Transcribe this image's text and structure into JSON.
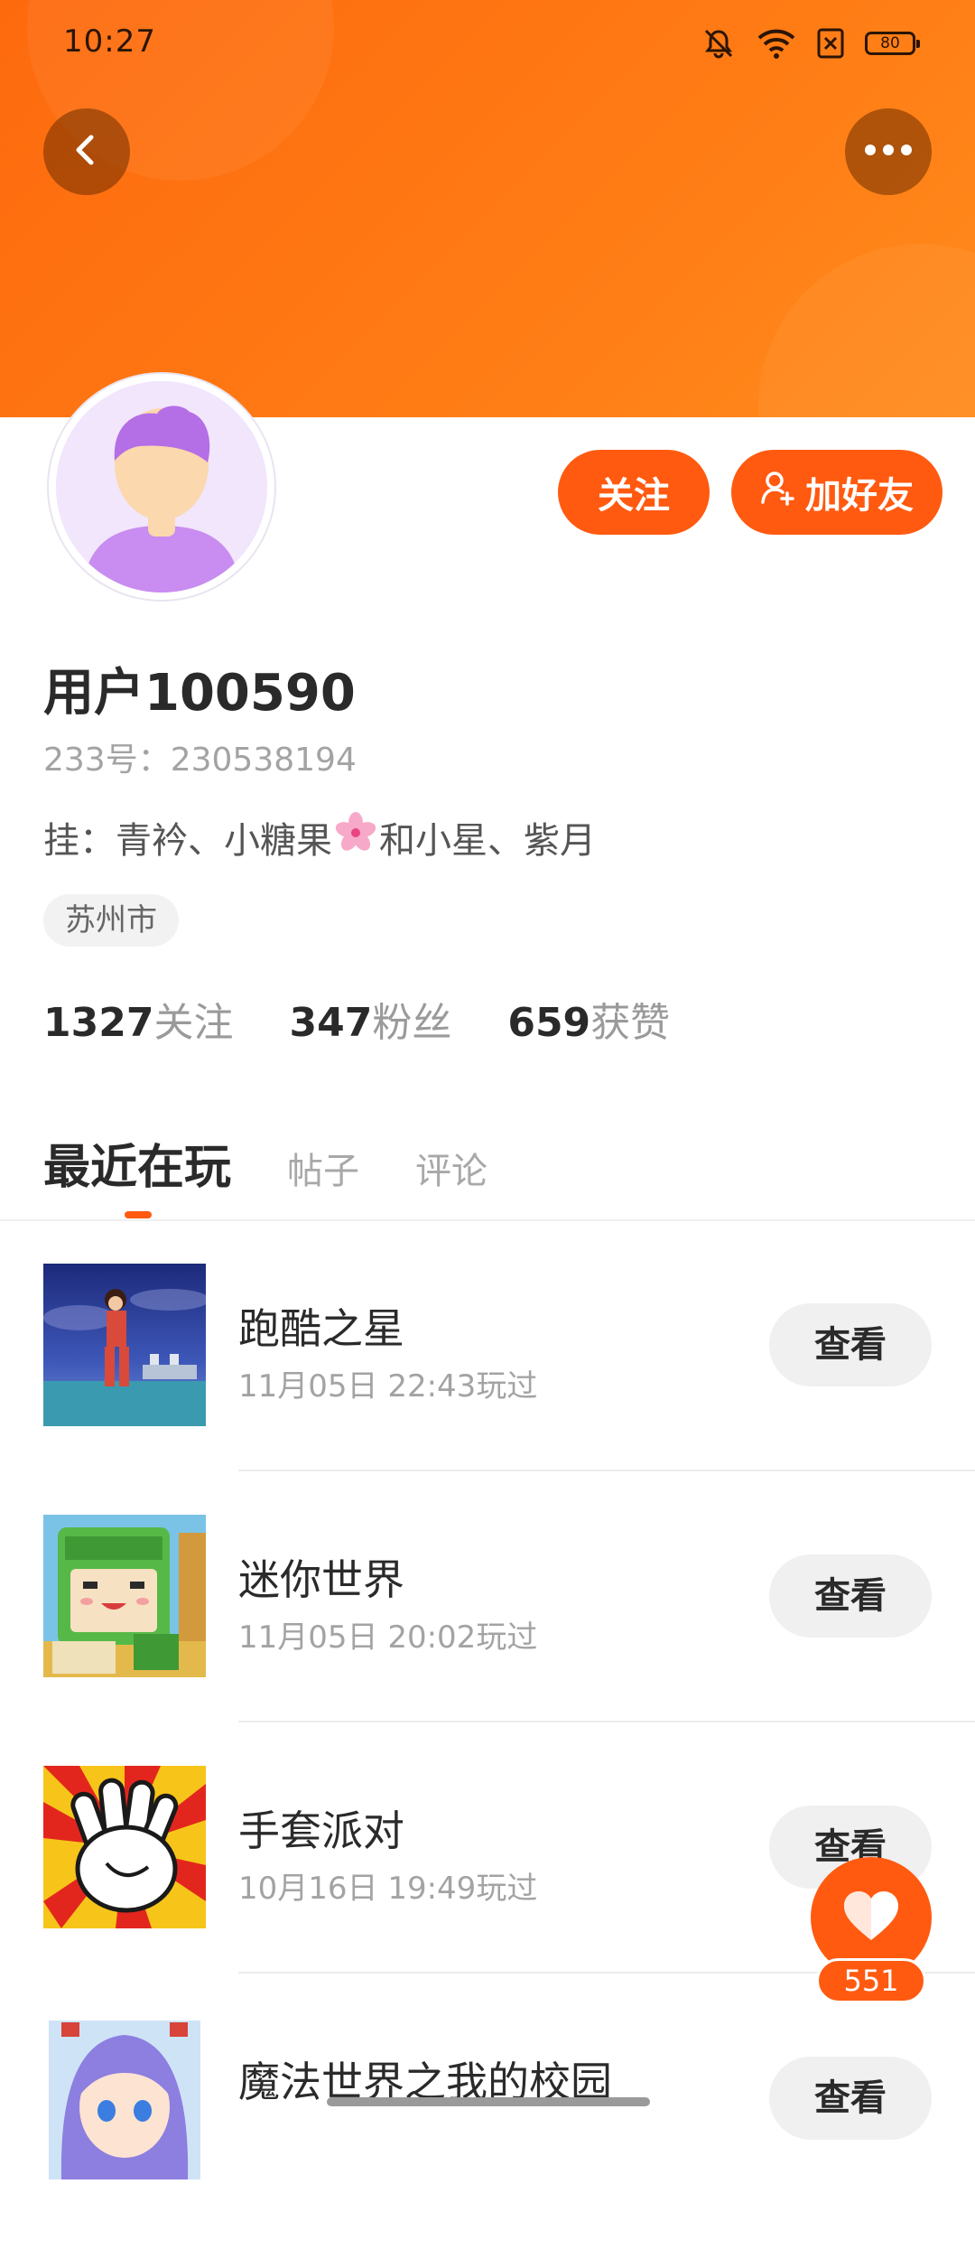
{
  "status_bar": {
    "time": "10:27",
    "battery": "80",
    "icons": [
      "mute-icon",
      "wifi-icon",
      "sim-off-icon",
      "battery-icon"
    ]
  },
  "header": {
    "back_icon": "chevron-left-icon",
    "more_icon": "more-dots-icon",
    "color_start": "#fd6a0e",
    "color_end": "#ff8b1c"
  },
  "profile": {
    "avatar_icon": "default-avatar-icon",
    "follow_label": "关注",
    "add_friend_label": "加好友",
    "username": "用户100590",
    "user_id": "233号：230538194",
    "bio_before": "挂：青衿、小糖果",
    "bio_emoji": "cherry-blossom-icon",
    "bio_after": "和小星、紫月",
    "location": "苏州市",
    "stats": [
      {
        "value": "1327",
        "label": "关注"
      },
      {
        "value": "347",
        "label": "粉丝"
      },
      {
        "value": "659",
        "label": "获赞"
      }
    ]
  },
  "tabs": [
    {
      "label": "最近在玩",
      "active": true
    },
    {
      "label": "帖子",
      "active": false
    },
    {
      "label": "评论",
      "active": false
    }
  ],
  "games": [
    {
      "title": "跑酷之星",
      "played": "11月05日 22:43玩过",
      "button": "查看"
    },
    {
      "title": "迷你世界",
      "played": "11月05日 20:02玩过",
      "button": "查看"
    },
    {
      "title": "手套派对",
      "played": "10月16日 19:49玩过",
      "button": "查看"
    },
    {
      "title": "魔法世界之我的校园",
      "played": "",
      "button": "查看"
    }
  ],
  "like": {
    "icon": "heart-icon",
    "count": "551"
  },
  "colors": {
    "accent": "#ff5a10",
    "text_primary": "#2a2a2a",
    "text_secondary": "#a3a3a3"
  }
}
